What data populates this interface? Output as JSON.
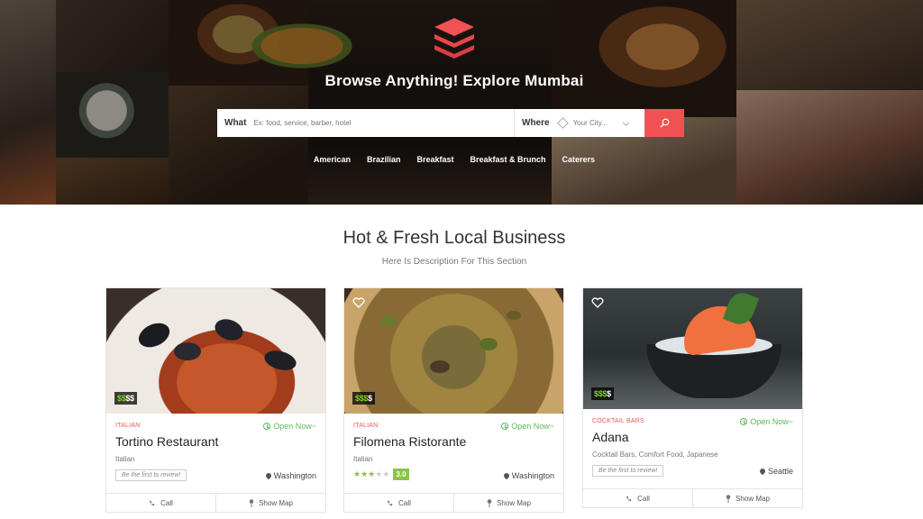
{
  "hero": {
    "title": "Browse Anything! Explore Mumbai",
    "search": {
      "what_label": "What",
      "what_placeholder": "Ex: food, service, barber, hotel",
      "where_label": "Where",
      "where_placeholder": "Your City..."
    },
    "categories": [
      "American",
      "Brazilian",
      "Breakfast",
      "Breakfast & Brunch",
      "Caterers"
    ]
  },
  "section": {
    "title": "Hot & Fresh Local Business",
    "subtitle": "Here Is Description For This Section"
  },
  "cards": [
    {
      "category": "ITALIAN",
      "status": "Open Now~",
      "name": "Tortino Restaurant",
      "tags": "Italian",
      "review_text": "Be the first to review!",
      "location": "Washington",
      "price_active": "$$",
      "price_inactive": "$$",
      "call_label": "Call",
      "map_label": "Show Map"
    },
    {
      "category": "ITALIAN",
      "status": "Open Now~",
      "name": "Filomena Ristorante",
      "tags": "Italian",
      "rating": "3.0",
      "rating_stars": 3,
      "location": "Washington",
      "price_active": "$$$",
      "price_inactive": "$",
      "call_label": "Call",
      "map_label": "Show Map"
    },
    {
      "category": "COCKTAIL BARS",
      "status": "Open Now~",
      "name": "Adana",
      "tags": "Cocktail Bars, Comfort Food, Japanese",
      "review_text": "Be the first to review!",
      "location": "Seattle",
      "price_active": "$$$",
      "price_inactive": "$",
      "call_label": "Call",
      "map_label": "Show Map"
    }
  ],
  "colors": {
    "accent": "#f15153",
    "open_green": "#5cb85c",
    "rating_green": "#8bc34a"
  }
}
